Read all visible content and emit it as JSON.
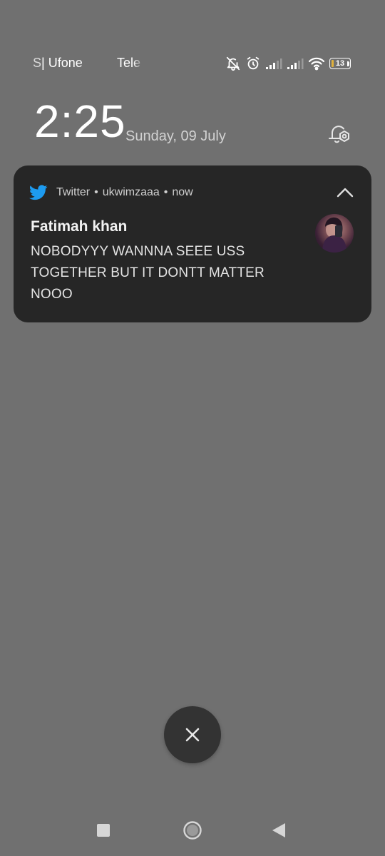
{
  "status_bar": {
    "carrier_1_prefix": "S",
    "carrier_1": "| Ufone",
    "carrier_2": "Tele",
    "battery_level": "13",
    "battery_fraction": 0.13,
    "battery_color": "#e0b13b"
  },
  "lock_screen": {
    "time": "2:25",
    "date": "Sunday, 09 July"
  },
  "notification": {
    "app_name": "Twitter",
    "separator": "•",
    "account": "ukwimzaaa",
    "time": "now",
    "sender": "Fatimah khan",
    "message": "NOBODYYY WANNNA SEEE USS TOGETHER BUT IT DONTT MATTER NOOO",
    "app_color": "#1d9bf0",
    "icons": {
      "app": "twitter-bird-icon",
      "collapse": "chevron-up-icon"
    }
  },
  "controls": {
    "dismiss_icon": "close-icon",
    "settings_icon": "notification-settings-icon"
  },
  "nav_bar": {
    "recents_icon": "square-icon",
    "home_icon": "circle-icon",
    "back_icon": "triangle-back-icon"
  },
  "colors": {
    "background": "#707070",
    "card": "#262626",
    "dismiss_button": "#333333"
  }
}
